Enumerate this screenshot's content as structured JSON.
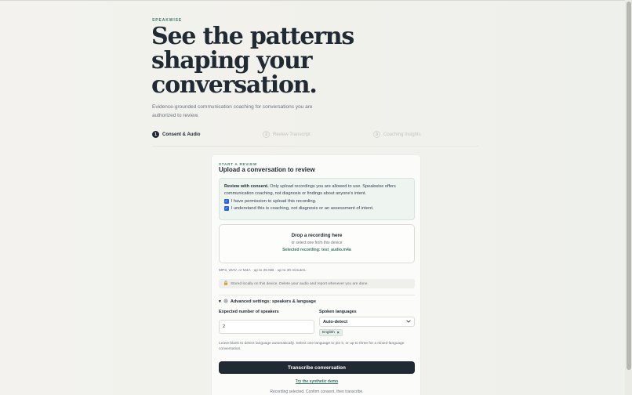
{
  "brand": "SPEAKWISE",
  "hero": {
    "line1": "See the patterns",
    "line2": "shaping your",
    "line3": "conversation."
  },
  "subtitle": "Evidence-grounded communication coaching for conversations you are authorized to review.",
  "steps": [
    {
      "num": "1",
      "label": "Consent & Audio",
      "state": "active"
    },
    {
      "num": "2",
      "label": "Review Transcript",
      "state": "inactive"
    },
    {
      "num": "3",
      "label": "Coaching Insights",
      "state": "inactive"
    }
  ],
  "card": {
    "eyebrow": "START A REVIEW",
    "title": "Upload a conversation to review",
    "consent": {
      "bold": "Review with consent.",
      "text": " Only upload recordings you are allowed to use. Speakwise offers communication coaching, not diagnosis or findings about anyone's intent.",
      "checkbox1": {
        "label": "I have permission to upload this recording.",
        "checked": true
      },
      "checkbox2": {
        "label": "I understand this is coaching, not diagnosis or an assessment of intent.",
        "checked": true
      }
    },
    "dropzone": {
      "title": "Drop a recording here",
      "subtitle": "or select one from this device",
      "selected": "Selected recording: test_audio.m4a"
    },
    "file_info": "MP3, WAV, or M4A · up to 25 MB · up to 30 minutes.",
    "storage_note": "Stored locally on this device. Delete your audio and report whenever you are done.",
    "advanced_label": "Advanced settings: speakers & language",
    "speakers": {
      "label": "Expected number of speakers",
      "value": "2"
    },
    "languages": {
      "label": "Spoken languages",
      "selected": "Auto-detect",
      "chip": "English"
    },
    "help_text": "Leave blank to detect language automatically. Select one language to pin it, or up to three for a mixed-language conversation.",
    "primary_button": "Transcribe conversation",
    "demo_link": "Try the synthetic demo",
    "status": "Recording selected. Confirm consent, then transcribe."
  },
  "colors": {
    "accent": "#3c7a6a",
    "dark": "#1f2a33",
    "checkbox": "#2563eb"
  }
}
